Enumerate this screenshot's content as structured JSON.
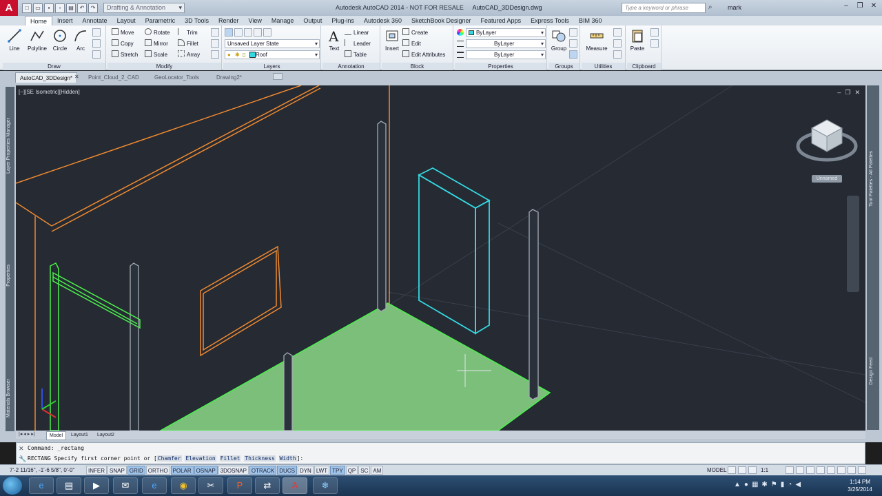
{
  "titlebar": {
    "logo": "A",
    "workspace": "Drafting & Annotation",
    "product_title": "Autodesk AutoCAD 2014 - NOT FOR RESALE",
    "file_name": "AutoCAD_3DDesign.dwg",
    "search_placeholder": "Type a keyword or phrase",
    "user": "mark"
  },
  "ribbon_tabs": [
    "Home",
    "Insert",
    "Annotate",
    "Layout",
    "Parametric",
    "3D Tools",
    "Render",
    "View",
    "Manage",
    "Output",
    "Plug-ins",
    "Autodesk 360",
    "SketchBook Designer",
    "Featured Apps",
    "Express Tools",
    "BIM 360"
  ],
  "draw": {
    "label": "Draw",
    "line": "Line",
    "polyline": "Polyline",
    "circle": "Circle",
    "arc": "Arc"
  },
  "modify": {
    "label": "Modify",
    "move": "Move",
    "rotate": "Rotate",
    "trim": "Trim",
    "copy": "Copy",
    "mirror": "Mirror",
    "fillet": "Fillet",
    "stretch": "Stretch",
    "scale": "Scale",
    "array": "Array"
  },
  "layers": {
    "label": "Layers",
    "layer_state": "Unsaved Layer State",
    "current_layer": "Roof"
  },
  "annotation": {
    "label": "Annotation",
    "text": "Text",
    "linear": "Linear",
    "leader": "Leader",
    "table": "Table"
  },
  "block": {
    "label": "Block",
    "insert": "Insert",
    "create": "Create",
    "edit": "Edit",
    "edit_attributes": "Edit Attributes"
  },
  "properties": {
    "label": "Properties",
    "color": "ByLayer",
    "linetype": "ByLayer",
    "lineweight": "ByLayer"
  },
  "groups": {
    "label": "Groups",
    "group": "Group"
  },
  "utilities": {
    "label": "Utilities",
    "measure": "Measure"
  },
  "clipboard": {
    "label": "Clipboard",
    "paste": "Paste"
  },
  "doc_tabs": [
    "AutoCAD_3DDesign*",
    "Point_Cloud_2_CAD",
    "GeoLocator_Tools",
    "Drawing2*"
  ],
  "viewport": {
    "label": "[−][SE Isometric][Hidden]",
    "viewcube_label": "Unnamed"
  },
  "left_palettes": [
    "Layer Properties Manager",
    "Properties",
    "Materials Browser"
  ],
  "right_palettes": [
    "Tool Palettes - All Palettes",
    "Design Feed"
  ],
  "layout_tabs": [
    "Model",
    "Layout1",
    "Layout2"
  ],
  "command": {
    "history": "Command: _rectang",
    "prompt": "RECTANG Specify first corner point or [",
    "options": [
      "Chamfer",
      "Elevation",
      "Fillet",
      "Thickness",
      "Width"
    ],
    "prompt_end": "]:"
  },
  "status": {
    "coords": "7'-2 11/16\", -1'-6 5/8\", 0'-0\"",
    "toggles": [
      {
        "label": "INFER",
        "on": false
      },
      {
        "label": "SNAP",
        "on": false
      },
      {
        "label": "GRID",
        "on": true
      },
      {
        "label": "ORTHO",
        "on": false
      },
      {
        "label": "POLAR",
        "on": true
      },
      {
        "label": "OSNAP",
        "on": true
      },
      {
        "label": "3DOSNAP",
        "on": false
      },
      {
        "label": "OTRACK",
        "on": true
      },
      {
        "label": "DUCS",
        "on": true
      },
      {
        "label": "DYN",
        "on": false
      },
      {
        "label": "LWT",
        "on": false
      },
      {
        "label": "TPY",
        "on": true
      },
      {
        "label": "QP",
        "on": false
      },
      {
        "label": "SC",
        "on": false
      },
      {
        "label": "AM",
        "on": false
      }
    ],
    "model": "MODEL",
    "scale": "1:1"
  },
  "taskbar": {
    "time": "1:14 PM",
    "date": "3/25/2014"
  },
  "colors": {
    "roof_orange": "#f08a30",
    "glass_cyan": "#35d8e0",
    "floor_green": "#7ec87e",
    "selection_green": "#4cf04c"
  }
}
